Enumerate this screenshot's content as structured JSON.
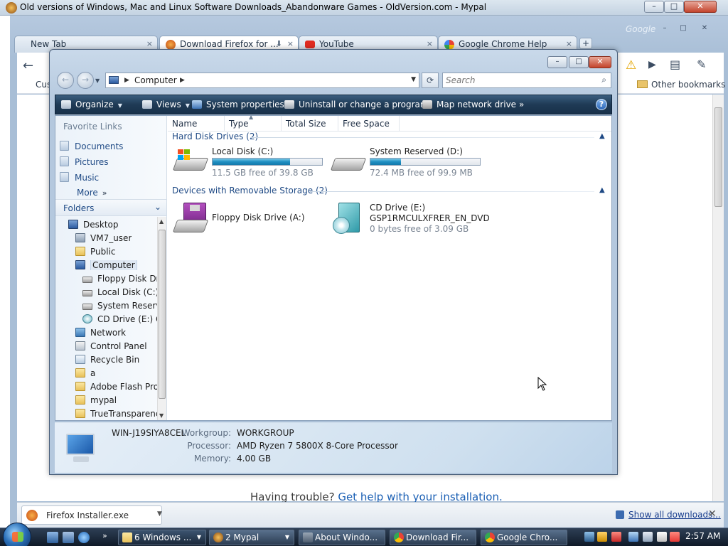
{
  "mypal_window": {
    "title": "Old versions of Windows, Mac and Linux Software Downloads_Abandonware Games - OldVersion.com - Mypal",
    "min_label": "–",
    "max_label": "□",
    "close_label": "✕"
  },
  "chrome": {
    "brand_text": "Google",
    "tabs": [
      {
        "label": "New Tab",
        "close": "×"
      },
      {
        "label": "Download Firefox for ...",
        "close": "×"
      },
      {
        "label": "YouTube",
        "close": "×"
      },
      {
        "label": "Google Chrome Help",
        "close": "×"
      }
    ],
    "new_tab_label": "+",
    "window_min": "–",
    "window_max": "□",
    "window_close": "✕",
    "bookmark_partial": "Cus",
    "other_bookmarks": "Other bookmarks",
    "page_trouble_text": "Having trouble? ",
    "page_trouble_link": "Get help with your installation.",
    "download_file": "Firefox Installer.exe",
    "show_all_downloads": "Show all downloads...",
    "download_bar_close": "✕",
    "colors": {
      "accent": "#1a5fb4",
      "frame": "#b6c9df"
    }
  },
  "explorer": {
    "window_buttons": {
      "min": "–",
      "max": "□",
      "close": "✕"
    },
    "address": {
      "crumb": "Computer"
    },
    "search": {
      "placeholder": "Search"
    },
    "commands": {
      "organize": "Organize",
      "views": "Views",
      "system_properties": "System properties",
      "uninstall": "Uninstall or change a program",
      "map_drive": "Map network drive",
      "more": "»",
      "help": "?"
    },
    "favorite_links": {
      "title": "Favorite Links",
      "items": [
        "Documents",
        "Pictures",
        "Music"
      ],
      "more": "More"
    },
    "folders": {
      "title": "Folders",
      "tree": [
        "Desktop",
        "VM7_user",
        "Public",
        "Computer",
        "Floppy Disk Dr",
        "Local Disk (C:)",
        "System Reserve",
        "CD Drive (E:) G",
        "Network",
        "Control Panel",
        "Recycle Bin",
        "a",
        "Adobe Flash Pro",
        "mypal",
        "TrueTransparenc"
      ]
    },
    "columns": [
      "Name",
      "Type",
      "Total Size",
      "Free Space"
    ],
    "groups": {
      "hard_disks": "Hard Disk Drives (2)",
      "removable": "Devices with Removable Storage (2)"
    },
    "drives": {
      "c": {
        "name": "Local Disk (C:)",
        "free_text": "11.5 GB free of 39.8 GB",
        "used_fraction": 0.71
      },
      "d": {
        "name": "System Reserved (D:)",
        "free_text": "72.4 MB free of 99.9 MB",
        "used_fraction": 0.28
      },
      "a": {
        "name": "Floppy Disk Drive (A:)"
      },
      "e": {
        "name": "CD Drive (E:)",
        "label": "GSP1RMCULXFRER_EN_DVD",
        "free_text": "0 bytes free of 3.09 GB"
      }
    },
    "details": {
      "computer_name": "WIN-J19SIYA8CEL",
      "workgroup_key": "Workgroup:",
      "workgroup_value": "WORKGROUP",
      "processor_key": "Processor:",
      "processor_value": "AMD Ryzen 7 5800X 8-Core Processor",
      "memory_key": "Memory:",
      "memory_value": "4.00 GB"
    }
  },
  "taskbar": {
    "more": "»",
    "buttons": [
      "6 Windows ...",
      "2 Mypal",
      "About Windo...",
      "Download Fir...",
      "Google Chro..."
    ],
    "clock": "2:57 AM"
  }
}
